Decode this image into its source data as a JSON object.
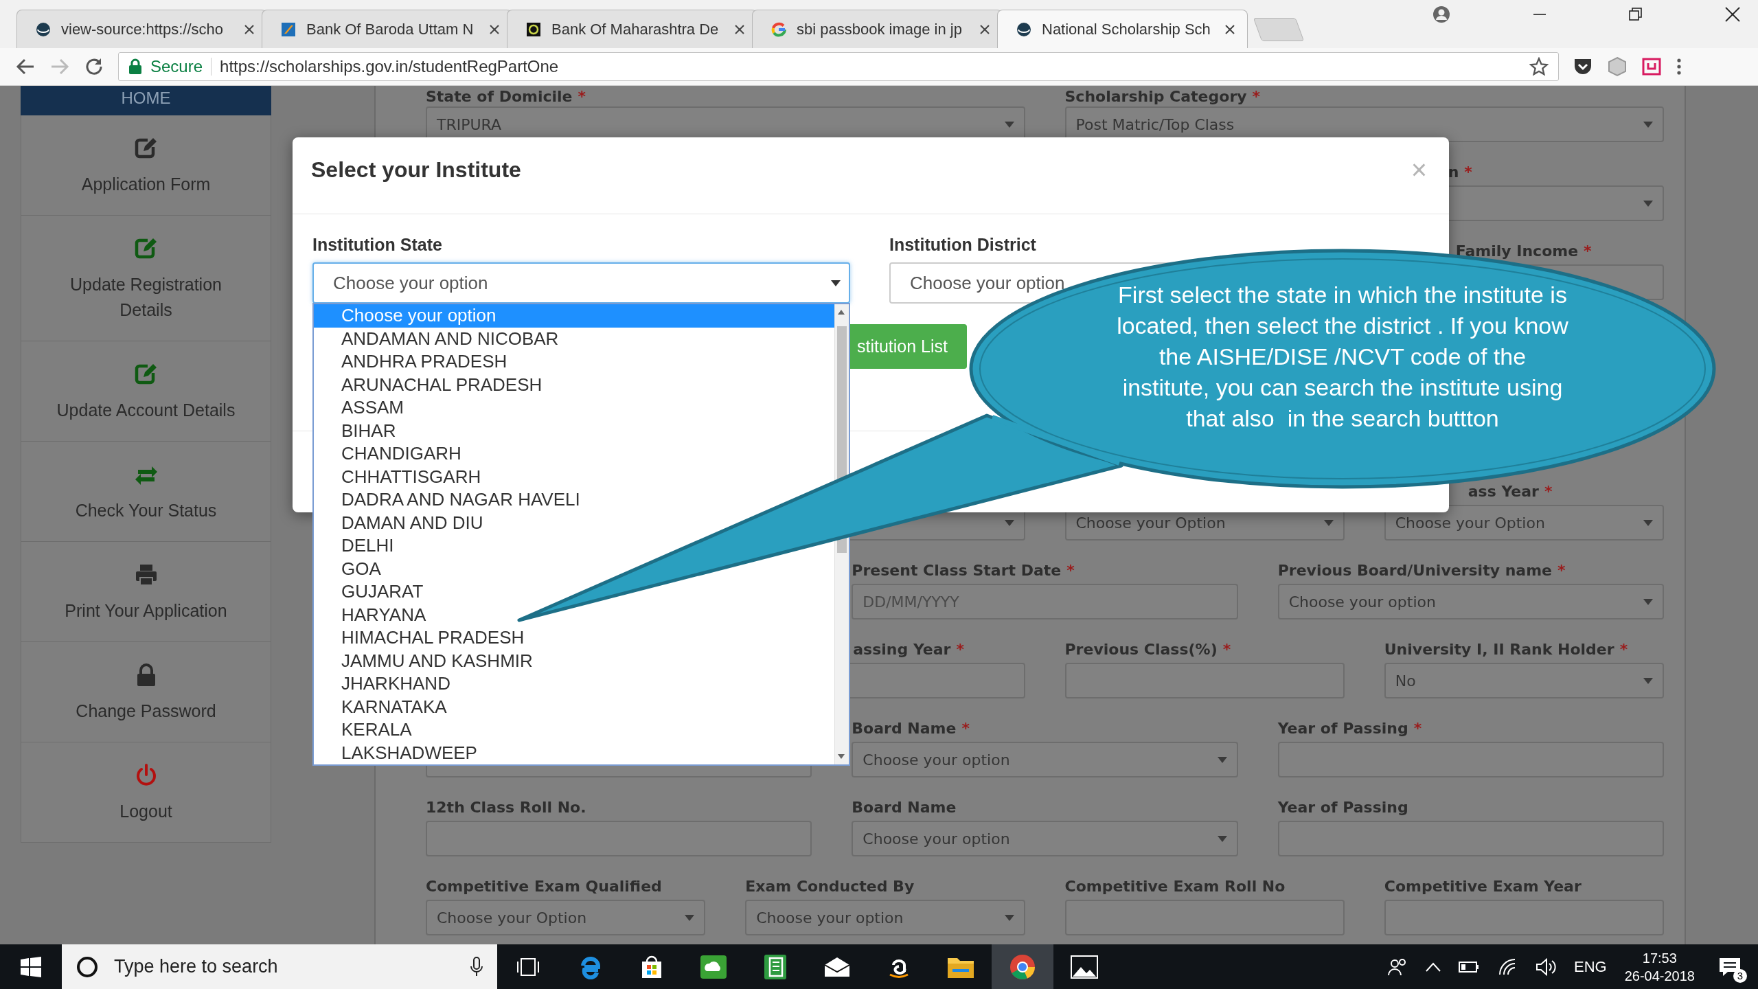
{
  "browser": {
    "tabs": [
      {
        "title": "view-source:https://scho",
        "selected": false
      },
      {
        "title": "Bank Of Baroda Uttam N",
        "selected": false
      },
      {
        "title": "Bank Of Maharashtra De",
        "selected": false
      },
      {
        "title": "sbi passbook image in jp",
        "selected": false
      },
      {
        "title": "National Scholarship Sch",
        "selected": true
      }
    ],
    "security_label": "Secure",
    "url": "https://scholarships.gov.in/studentRegPartOne"
  },
  "sidebar": {
    "header": "HOME",
    "items": [
      {
        "label": "Application Form"
      },
      {
        "label": "Update Registration Details"
      },
      {
        "label": "Update Account Details"
      },
      {
        "label": "Check Your Status"
      },
      {
        "label": "Print Your Application"
      },
      {
        "label": "Change Password"
      },
      {
        "label": "Logout"
      }
    ]
  },
  "form": {
    "rows": [
      {
        "fields": [
          {
            "label": "State of Domicile",
            "required_mark": "*",
            "kind": "select",
            "value": "TRIPURA"
          },
          {
            "label": "Scholarship Category",
            "required_mark": "*",
            "kind": "select",
            "value": "Post Matric/Top Class"
          }
        ]
      },
      {
        "fields": [
          {
            "label": "n",
            "required_mark": "*",
            "kind": "select"
          }
        ]
      },
      {
        "fields": [
          {
            "label": "Family Income",
            "required_mark": "*",
            "kind": "input"
          }
        ]
      },
      {
        "fields": [
          {
            "kind": "select"
          },
          {
            "kind": "select",
            "value": "Choose your Option"
          },
          {
            "label": "ass Year",
            "required_mark": "*",
            "kind": "select",
            "value": "Choose your Option"
          }
        ]
      },
      {
        "fields": [
          {
            "label": "Present Class Start Date",
            "required_mark": "*",
            "kind": "input",
            "placeholder": "DD/MM/YYYY"
          },
          {
            "label": "Previous Board/University name",
            "required_mark": "*",
            "kind": "select",
            "value": "Choose your option"
          }
        ]
      },
      {
        "fields": [
          {
            "label": "assing Year",
            "required_mark": "*",
            "kind": "input"
          },
          {
            "label": "Previous Class(%)",
            "required_mark": "*",
            "kind": "input"
          },
          {
            "label": "University I, II Rank Holder",
            "required_mark": "*",
            "kind": "select",
            "value": "No"
          }
        ]
      },
      {
        "fields": [
          {
            "kind": "input"
          },
          {
            "label": "Board Name",
            "required_mark": "*",
            "kind": "select",
            "value": "Choose your option"
          },
          {
            "label": "Year of Passing",
            "required_mark": "*",
            "kind": "input"
          }
        ]
      },
      {
        "fields": [
          {
            "label": "12th Class Roll No.",
            "kind": "input"
          },
          {
            "label": "Board Name",
            "kind": "select",
            "value": "Choose your option"
          },
          {
            "label": "Year of Passing",
            "kind": "input"
          }
        ]
      },
      {
        "fields": [
          {
            "label": "Competitive Exam Qualified",
            "kind": "select",
            "value": "Choose your Option"
          },
          {
            "label": "Exam Conducted By",
            "kind": "select",
            "value": "Choose your option"
          },
          {
            "label": "Competitive Exam Roll No",
            "kind": "input"
          },
          {
            "label": "Competitive Exam Year",
            "kind": "input"
          }
        ]
      }
    ]
  },
  "modal": {
    "title": "Select your Institute",
    "close": "×",
    "fields": [
      {
        "label": "Institution State",
        "value": "Choose your option",
        "focused": true
      },
      {
        "label": "Institution District",
        "value": "Choose your option",
        "focused": false
      }
    ],
    "button": "stitution List"
  },
  "dropdown": {
    "options": [
      {
        "label": "Choose your option",
        "selected": true
      },
      {
        "label": "ANDAMAN AND NICOBAR",
        "selected": false
      },
      {
        "label": "ANDHRA PRADESH",
        "selected": false
      },
      {
        "label": "ARUNACHAL PRADESH",
        "selected": false
      },
      {
        "label": "ASSAM",
        "selected": false
      },
      {
        "label": "BIHAR",
        "selected": false
      },
      {
        "label": "CHANDIGARH",
        "selected": false
      },
      {
        "label": "CHHATTISGARH",
        "selected": false
      },
      {
        "label": "DADRA AND NAGAR HAVELI",
        "selected": false
      },
      {
        "label": "DAMAN AND DIU",
        "selected": false
      },
      {
        "label": "DELHI",
        "selected": false
      },
      {
        "label": "GOA",
        "selected": false
      },
      {
        "label": "GUJARAT",
        "selected": false
      },
      {
        "label": "HARYANA",
        "selected": false
      },
      {
        "label": "HIMACHAL PRADESH",
        "selected": false
      },
      {
        "label": "JAMMU AND KASHMIR",
        "selected": false
      },
      {
        "label": "JHARKHAND",
        "selected": false
      },
      {
        "label": "KARNATAKA",
        "selected": false
      },
      {
        "label": "KERALA",
        "selected": false
      },
      {
        "label": "LAKSHADWEEP",
        "selected": false
      }
    ]
  },
  "callout": {
    "text": "First select the state in which the institute is located, then select the district . If you know the AISHE/DISE /NCVT code of the institute, you can search the institute using that also  in the search buttton"
  },
  "taskbar": {
    "search_placeholder": "Type here to search",
    "language": "ENG",
    "time": "17:53",
    "date": "26-04-2018",
    "notification_count": "3"
  }
}
